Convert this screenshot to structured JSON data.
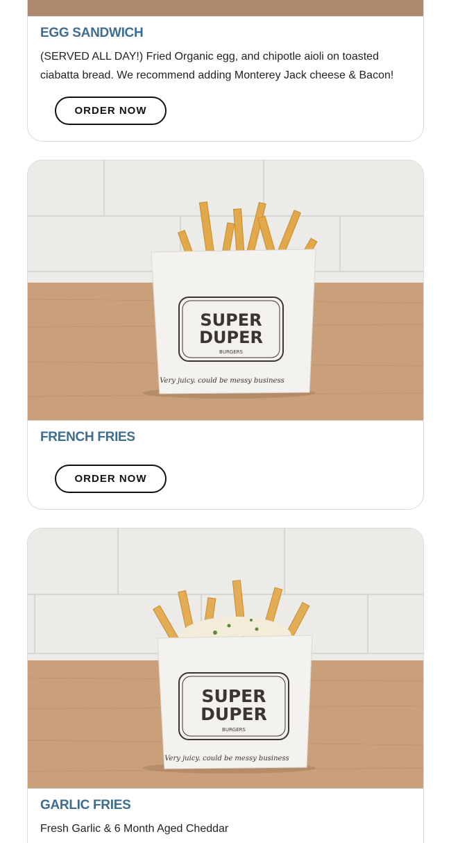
{
  "menu": {
    "items": [
      {
        "title": "EGG SANDWICH",
        "description": "(SERVED ALL DAY!) Fried Organic egg, and chipotle aioli on toasted ciabatta bread. We recommend adding Monterey Jack cheese & Bacon!",
        "button_label": "ORDER NOW"
      },
      {
        "title": "FRENCH FRIES",
        "description": "",
        "button_label": "ORDER NOW",
        "bag_brand_line1": "SUPER",
        "bag_brand_line2": "DUPER",
        "bag_brand_sub": "BURGERS",
        "bag_tagline": "Very juicy. could be messy business"
      },
      {
        "title": "GARLIC FRIES",
        "description": "Fresh Garlic & 6 Month Aged Cheddar",
        "bag_brand_line1": "SUPER",
        "bag_brand_line2": "DUPER",
        "bag_brand_sub": "BURGERS",
        "bag_tagline": "Very juicy. could be messy business"
      }
    ]
  },
  "colors": {
    "title_blue": "#3d6d8f",
    "wall_white": "#efefec",
    "wood": "#c9a07a",
    "button_border": "#111111"
  }
}
